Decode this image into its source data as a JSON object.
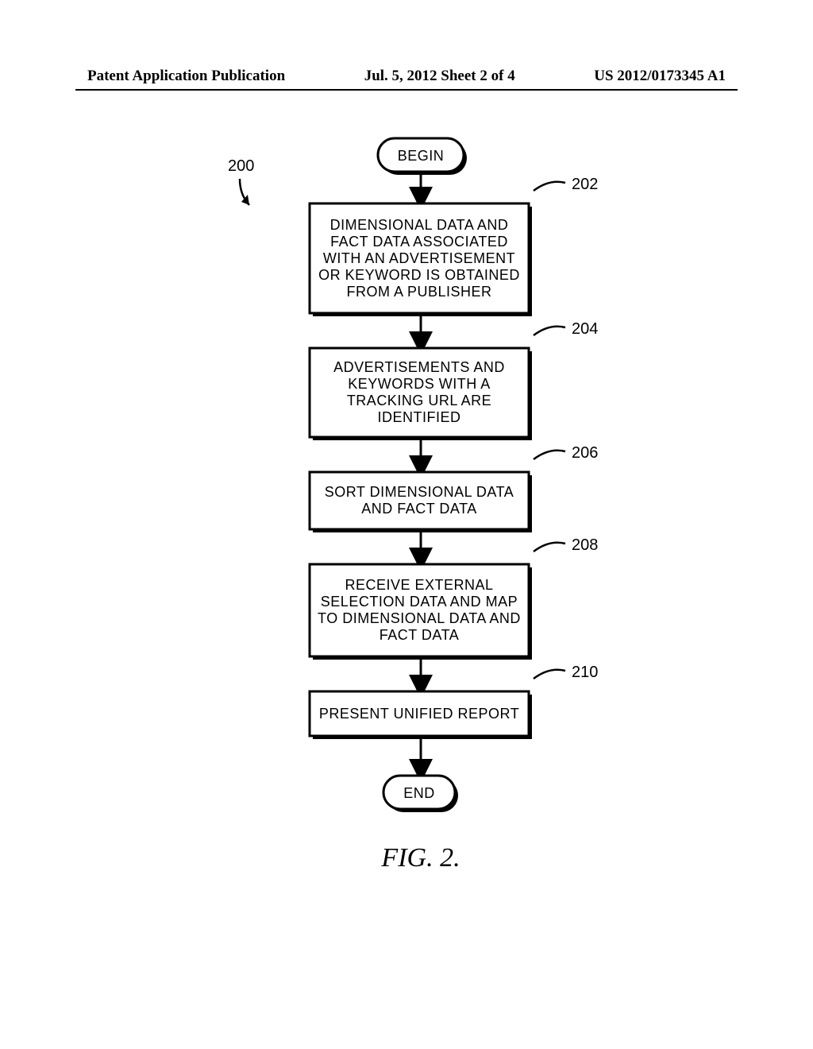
{
  "header": {
    "left": "Patent Application Publication",
    "mid": "Jul. 5, 2012  Sheet 2 of 4",
    "right": "US 2012/0173345 A1"
  },
  "flow": {
    "ref_label": "200",
    "begin": "BEGIN",
    "end": "END",
    "caption": "FIG. 2.",
    "steps": [
      {
        "ref": "202",
        "text": "DIMENSIONAL DATA AND FACT DATA ASSOCIATED WITH AN ADVERTISEMENT OR KEYWORD IS OBTAINED FROM A PUBLISHER"
      },
      {
        "ref": "204",
        "text": "ADVERTISEMENTS AND KEYWORDS WITH A TRACKING URL ARE IDENTIFIED"
      },
      {
        "ref": "206",
        "text": "SORT DIMENSIONAL DATA AND FACT DATA"
      },
      {
        "ref": "208",
        "text": "RECEIVE EXTERNAL SELECTION DATA AND MAP TO DIMENSIONAL DATA AND FACT DATA"
      },
      {
        "ref": "210",
        "text": "PRESENT UNIFIED REPORT"
      }
    ]
  }
}
